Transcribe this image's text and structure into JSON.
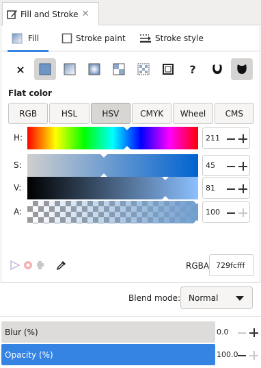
{
  "window": {
    "tab_title": "Fill and Stroke"
  },
  "subtabs": [
    {
      "label": "Fill",
      "icon": "fill-icon"
    },
    {
      "label": "Stroke paint",
      "icon": "stroke-paint-icon"
    },
    {
      "label": "Stroke style",
      "icon": "stroke-style-icon"
    }
  ],
  "paint_types": {
    "none": "×",
    "unset": "?",
    "selected": "flat-color"
  },
  "flat_color_label": "Flat color",
  "color_modes": [
    "RGB",
    "HSL",
    "HSV",
    "CMYK",
    "Wheel",
    "CMS"
  ],
  "active_mode": "HSV",
  "sliders": [
    {
      "label": "H:",
      "value": "211"
    },
    {
      "label": "S:",
      "value": "45"
    },
    {
      "label": "V:",
      "value": "81"
    },
    {
      "label": "A:",
      "value": "100"
    }
  ],
  "rgba": {
    "label": "RGBA:",
    "value": "729fcfff"
  },
  "blend": {
    "label": "Blend mode:",
    "value": "Normal"
  },
  "blur": {
    "label": "Blur (%)",
    "value": "0.0"
  },
  "opacity": {
    "label": "Opacity (%)",
    "value": "100.0"
  },
  "colors": {
    "accent": "#3584e4",
    "current_color": "#729fcf"
  }
}
